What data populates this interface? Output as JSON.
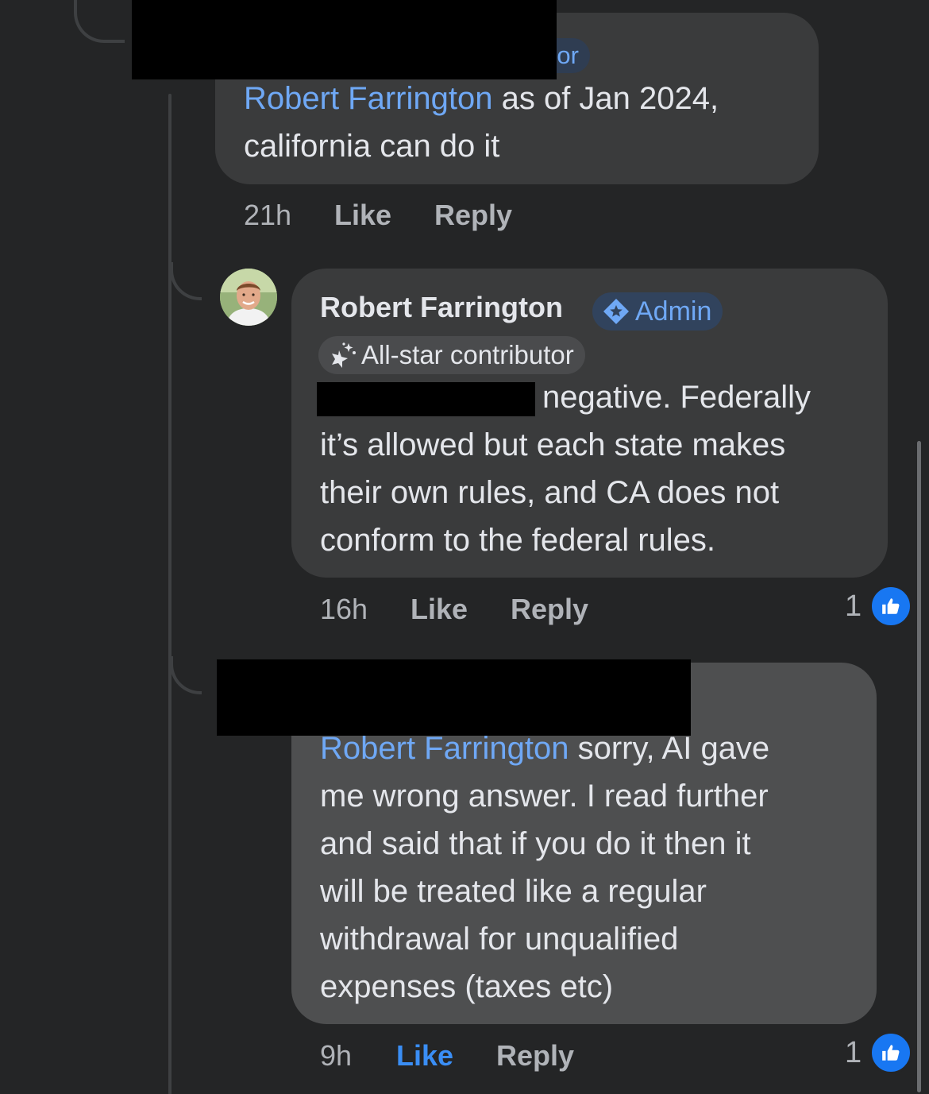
{
  "comments": [
    {
      "badge_partial": "or",
      "mention": "Robert Farrington",
      "text_line1": " as of Jan 2024,",
      "text_line2": "california can do it",
      "time": "21h",
      "like": "Like",
      "reply": "Reply"
    },
    {
      "author": "Robert Farrington",
      "admin_badge": "Admin",
      "contributor_badge": "All-star contributor",
      "lines": [
        "negative. Federally",
        "it’s allowed but each state makes",
        "their own rules, and CA does not",
        "conform to the federal rules."
      ],
      "time": "16h",
      "like": "Like",
      "reply": "Reply",
      "reaction_count": "1"
    },
    {
      "mention": "Robert Farrington",
      "line1_rest": " sorry, AI gave",
      "lines": [
        "me wrong answer.  I read further",
        "and said that if you do it then it",
        "will be treated like a regular",
        "withdrawal for unqualified",
        "expenses (taxes etc)"
      ],
      "time": "9h",
      "like": "Like",
      "reply": "Reply",
      "reaction_count": "1",
      "liked_by_viewer": true
    }
  ],
  "colors": {
    "background": "#242526",
    "bubble": "#3a3b3c",
    "bubble_highlight": "#4e4f50",
    "mention": "#6fa8f5",
    "like_active": "#3a8ef5",
    "reaction_blue": "#1877f2"
  }
}
